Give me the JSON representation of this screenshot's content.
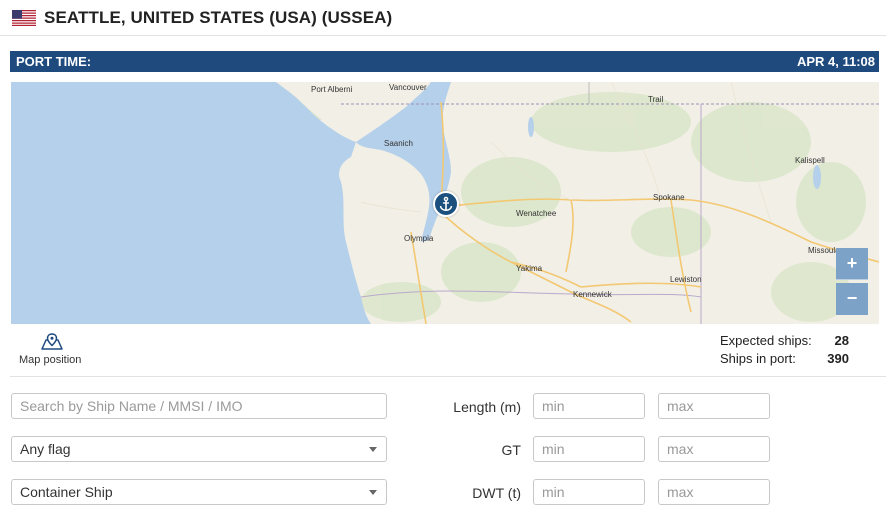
{
  "header": {
    "flag_icon": "us-flag-icon",
    "title": "SEATTLE, UNITED STATES (USA) (USSEA)"
  },
  "port_time": {
    "label": "PORT TIME:",
    "value": "APR 4, 11:08"
  },
  "map": {
    "places": [
      "Port Alberni",
      "Vancouver",
      "Trail",
      "Saanich",
      "Kalispell",
      "Spokane",
      "Wenatchee",
      "Olympia",
      "Missoula",
      "Yakima",
      "Lewiston",
      "Kennewick"
    ],
    "marker_icon": "anchor-icon",
    "zoom_in": "+",
    "zoom_out": "−",
    "colors": {
      "water": "#b5d0ea",
      "land": "#f2efe6",
      "marker": "#1b4f7e",
      "zoom": "#7da2c7"
    }
  },
  "map_position": {
    "icon": "map-pin-icon",
    "label": "Map position"
  },
  "stats": {
    "expected_label": "Expected ships:",
    "expected_value": "28",
    "inport_label": "Ships in port:",
    "inport_value": "390"
  },
  "filters": {
    "search_placeholder": "Search by Ship Name / MMSI / IMO",
    "flag_value": "Any flag",
    "type_value": "Container Ship",
    "length_label": "Length (m)",
    "gt_label": "GT",
    "dwt_label": "DWT (t)",
    "min_placeholder": "min",
    "max_placeholder": "max"
  },
  "colors": {
    "header_bar": "#1f4a7e"
  }
}
